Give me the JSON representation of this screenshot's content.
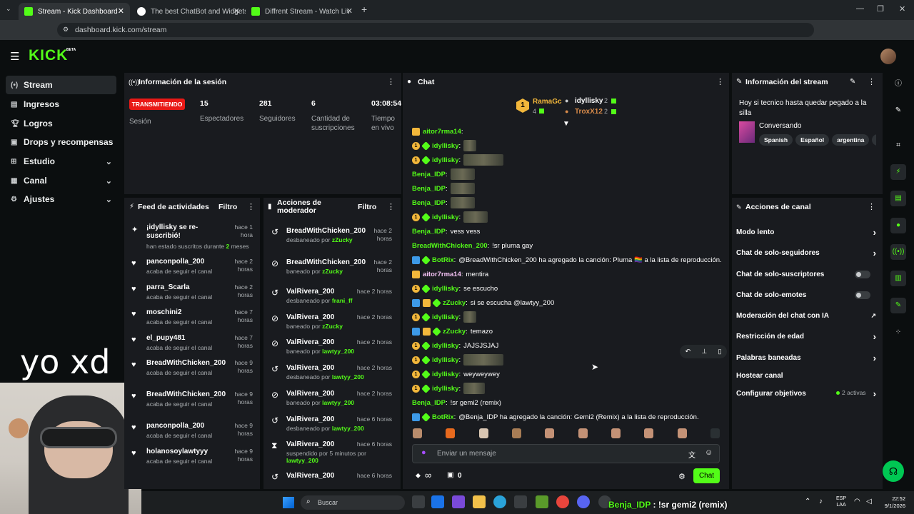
{
  "browser": {
    "tabs": [
      {
        "title": "Stream - Kick Dashboard",
        "active": true
      },
      {
        "title": "The best ChatBot and Widgets",
        "active": false
      },
      {
        "title": "Diffrent Stream - Watch Live on",
        "active": false
      }
    ],
    "new_tab": "+",
    "url": "dashboard.kick.com/stream"
  },
  "header": {
    "logo": "KICK",
    "beta": "BETA"
  },
  "sidebar": {
    "items": [
      {
        "label": "Stream",
        "icon": "stream-icon",
        "active": true
      },
      {
        "label": "Ingresos",
        "icon": "dollar-icon"
      },
      {
        "label": "Logros",
        "icon": "trophy-icon"
      },
      {
        "label": "Drops y recompensas",
        "icon": "gift-icon"
      },
      {
        "label": "Estudio",
        "icon": "studio-icon",
        "expandable": true
      },
      {
        "label": "Canal",
        "icon": "channel-icon",
        "expandable": true
      },
      {
        "label": "Ajustes",
        "icon": "gear-icon",
        "expandable": true
      }
    ]
  },
  "session": {
    "title": "Información de la sesión",
    "status": "TRANSMITIENDO",
    "status_label": "Sesión",
    "stats": [
      {
        "value": "15",
        "label": "Espectadores"
      },
      {
        "value": "281",
        "label": "Seguidores"
      },
      {
        "value": "6",
        "label": "Cantidad de suscripciones"
      },
      {
        "value": "03:08:54",
        "label": "Tiempo en vivo"
      }
    ]
  },
  "feed": {
    "title": "Feed de actividades",
    "filter": "Filtro",
    "items": [
      {
        "name": "¡idyllisky se re-suscribió!",
        "sub": "han estado suscritos durante",
        "sub_highlight": "2",
        "sub_tail": " meses",
        "time": "hace 1 hora",
        "icon": "sparkle-icon"
      },
      {
        "name": "panconpolla_200",
        "sub": "acaba de seguir el canal",
        "time": "hace 2 horas",
        "icon": "heart-icon"
      },
      {
        "name": "parra_Scarla",
        "sub": "acaba de seguir el canal",
        "time": "hace 2 horas",
        "icon": "heart-icon"
      },
      {
        "name": "moschini2",
        "sub": "acaba de seguir el canal",
        "time": "hace 7 horas",
        "icon": "heart-icon"
      },
      {
        "name": "el_pupy481",
        "sub": "acaba de seguir el canal",
        "time": "hace 7 horas",
        "icon": "heart-icon"
      },
      {
        "name": "BreadWithChicken_200",
        "sub": "acaba de seguir el canal",
        "time": "hace 9 horas",
        "icon": "heart-icon"
      },
      {
        "name": "BreadWithChicken_200",
        "sub": "acaba de seguir el canal",
        "time": "hace 9 horas",
        "icon": "heart-icon"
      },
      {
        "name": "panconpolla_200",
        "sub": "acaba de seguir el canal",
        "time": "hace 9 horas",
        "icon": "heart-icon"
      },
      {
        "name": "holanosoylawtyyy",
        "sub": "acaba de seguir el canal",
        "time": "hace 9 horas",
        "icon": "heart-icon"
      }
    ]
  },
  "overlay": {
    "caption": "yo xd"
  },
  "mod": {
    "title": "Acciones de moderador",
    "filter": "Filtro",
    "items": [
      {
        "name": "BreadWithChicken_200",
        "action": "desbaneado por",
        "by": "zZucky",
        "time": "hace 2 horas",
        "icon": "undo-icon"
      },
      {
        "name": "BreadWithChicken_200",
        "action": "baneado por",
        "by": "zZucky",
        "time": "hace 2 horas",
        "icon": "ban-icon"
      },
      {
        "name": "ValRivera_200",
        "action": "desbaneado por",
        "by": "frani_ff",
        "time": "hace 2 horas",
        "icon": "undo-icon"
      },
      {
        "name": "ValRivera_200",
        "action": "baneado por",
        "by": "zZucky",
        "time": "hace 2 horas",
        "icon": "ban-icon"
      },
      {
        "name": "ValRivera_200",
        "action": "baneado por",
        "by": "lawtyy_200",
        "time": "hace 2 horas",
        "icon": "ban-icon"
      },
      {
        "name": "ValRivera_200",
        "action": "desbaneado por",
        "by": "lawtyy_200",
        "time": "hace 2 horas",
        "icon": "undo-icon"
      },
      {
        "name": "ValRivera_200",
        "action": "baneado por",
        "by": "lawtyy_200",
        "time": "hace 2 horas",
        "icon": "ban-icon"
      },
      {
        "name": "ValRivera_200",
        "action": "desbaneado por",
        "by": "lawtyy_200",
        "time": "hace 6 horas",
        "icon": "undo-icon"
      },
      {
        "name": "ValRivera_200",
        "action": "suspendido por 5 minutos por",
        "by": "lawtyy_200",
        "time": "hace 6 horas",
        "icon": "hourglass-icon"
      },
      {
        "name": "ValRivera_200",
        "action": "",
        "by": "",
        "time": "hace 6 horas",
        "icon": "undo-icon"
      }
    ]
  },
  "chat": {
    "title": "Chat",
    "leaderboard": [
      {
        "name": "RamaGc",
        "count": "4"
      },
      {
        "name": "idyllisky",
        "count": "2"
      },
      {
        "name": "TroxX12",
        "count": "2"
      }
    ],
    "messages": [
      {
        "user": "aitor7rma14",
        "text": "",
        "color": "#53fc18",
        "badges": [
          "b4"
        ]
      },
      {
        "user": "idyllisky",
        "text": "",
        "color": "#53fc18",
        "badges": [
          "b1",
          "b2"
        ],
        "emote": 18
      },
      {
        "user": "idyllisky",
        "text": "",
        "color": "#53fc18",
        "badges": [
          "b1",
          "b2"
        ],
        "emote": 56
      },
      {
        "user": "Benja_IDP",
        "text": "",
        "color": "#53fc18",
        "badges": [],
        "emote": 34
      },
      {
        "user": "Benja_IDP",
        "text": "",
        "color": "#53fc18",
        "badges": [],
        "emote": 34
      },
      {
        "user": "Benja_IDP",
        "text": "",
        "color": "#53fc18",
        "badges": [],
        "emote": 34
      },
      {
        "user": "idyllisky",
        "text": "",
        "color": "#53fc18",
        "badges": [
          "b1",
          "b2"
        ],
        "emote": 34
      },
      {
        "user": "Benja_IDP",
        "text": "vess vess",
        "color": "#53fc18",
        "badges": []
      },
      {
        "user": "BreadWithChicken_200",
        "text": "!sr pluma gay",
        "color": "#53fc18",
        "badges": []
      },
      {
        "user": "BotRix",
        "text": "@BreadWithChicken_200 ha agregado la canción: Pluma 🏳️‍🌈 a la lista de reproducción.",
        "color": "#53fc18",
        "badges": [
          "b3",
          "b2"
        ]
      },
      {
        "user": "aitor7rma14",
        "text": "mentira",
        "color": "#f5c2f5",
        "badges": [
          "b4"
        ]
      },
      {
        "user": "idyllisky",
        "text": "se escucho",
        "color": "#53fc18",
        "badges": [
          "b1",
          "b2"
        ]
      },
      {
        "user": "zZucky",
        "text": "si se escucha @lawtyy_200",
        "color": "#53fc18",
        "badges": [
          "b3",
          "b4",
          "b2"
        ]
      },
      {
        "user": "idyllisky",
        "text": "",
        "color": "#53fc18",
        "badges": [
          "b1",
          "b2"
        ],
        "emote": 18
      },
      {
        "user": "zZucky",
        "text": "temazo",
        "color": "#53fc18",
        "badges": [
          "b3",
          "b4",
          "b2"
        ]
      },
      {
        "user": "idyllisky",
        "text": "JAJSJSJAJ",
        "color": "#53fc18",
        "badges": [
          "b1",
          "b2"
        ]
      },
      {
        "user": "idyllisky",
        "text": "",
        "color": "#53fc18",
        "badges": [
          "b1",
          "b2"
        ],
        "emote": 56
      },
      {
        "user": "idyllisky",
        "text": "weyweywey",
        "color": "#53fc18",
        "badges": [
          "b1",
          "b2"
        ]
      },
      {
        "user": "idyllisky",
        "text": "",
        "color": "#53fc18",
        "badges": [
          "b1",
          "b2"
        ],
        "emote": 30
      },
      {
        "user": "Benja_IDP",
        "text": "!sr gemi2 (remix)",
        "color": "#53fc18",
        "badges": []
      },
      {
        "user": "BotRix",
        "text": "@Benja_IDP ha agregado la canción: Gemi2 (Remix) a la lista de reproducción.",
        "color": "#53fc18",
        "badges": [
          "b3",
          "b2"
        ]
      }
    ],
    "input_placeholder": "Enviar un mensaje",
    "send_label": "Chat",
    "points": "∞",
    "gift_count": "0"
  },
  "stream_info": {
    "title": "Información del stream",
    "stream_title": "Hoy si tecnico hasta quedar pegado a la silla",
    "category": "Conversando",
    "tags": [
      "Spanish",
      "Español",
      "argentina",
      "ch"
    ]
  },
  "channel_actions": {
    "title": "Acciones de canal",
    "items": [
      {
        "label": "Modo lento",
        "control": "chevron"
      },
      {
        "label": "Chat de solo-seguidores",
        "control": "chevron"
      },
      {
        "label": "Chat de solo-suscriptores",
        "control": "toggle"
      },
      {
        "label": "Chat de solo-emotes",
        "control": "toggle"
      },
      {
        "label": "Moderación del chat con IA",
        "control": "external"
      },
      {
        "label": "Restricción de edad",
        "control": "chevron"
      },
      {
        "label": "Palabras baneadas",
        "control": "chevron"
      },
      {
        "label": "Hostear canal",
        "control": "none"
      },
      {
        "label": "Configurar objetivos",
        "control": "chevron",
        "extra": "2 activas"
      }
    ]
  },
  "taskbar": {
    "search": "Buscar",
    "notification": "Benja_IDP : !sr gemi2 (remix)",
    "lang": "ESP",
    "lang2": "LAA",
    "time": "22:52",
    "date": "9/1/2026"
  },
  "colors": {
    "accent": "#53fc18",
    "live": "#e91916",
    "panel": "#191b1f",
    "bg": "#0b0e0f"
  }
}
